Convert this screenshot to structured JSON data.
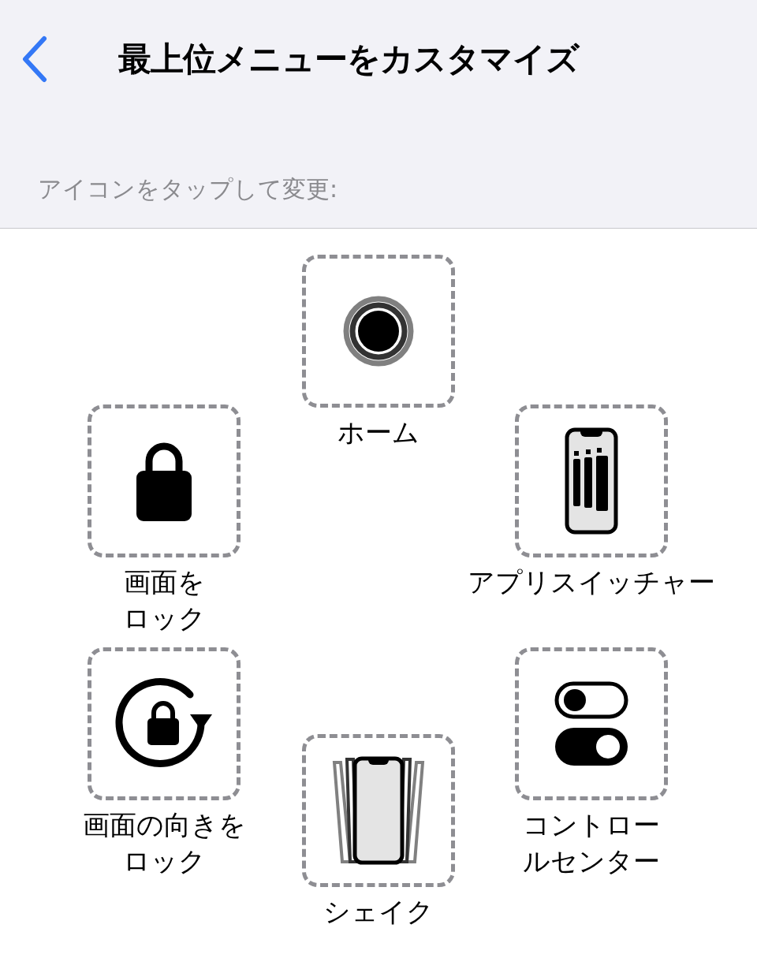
{
  "nav": {
    "title": "最上位メニューをカスタマイズ"
  },
  "section_header": "アイコンをタップして変更:",
  "items": [
    {
      "kind": "home",
      "label_lines": [
        "ホーム"
      ]
    },
    {
      "kind": "lock",
      "label_lines": [
        "画面を",
        "ロック"
      ]
    },
    {
      "kind": "switcher",
      "label_lines": [
        "アプリスイッチャー"
      ]
    },
    {
      "kind": "rotation",
      "label_lines": [
        "画面の向きを",
        "ロック"
      ]
    },
    {
      "kind": "shake",
      "label_lines": [
        "シェイク"
      ]
    },
    {
      "kind": "control",
      "label_lines": [
        "コントロー",
        "ルセンター"
      ]
    }
  ]
}
